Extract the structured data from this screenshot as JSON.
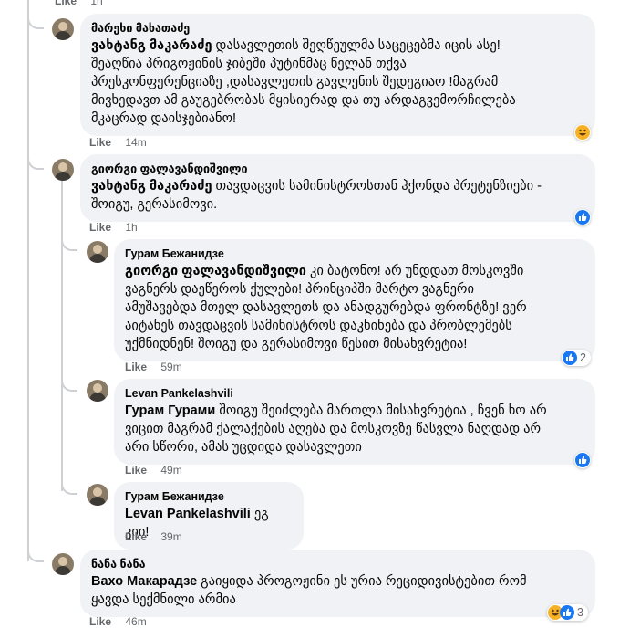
{
  "top_meta": {
    "like": "Like",
    "time": "1h"
  },
  "comments": [
    {
      "author": "მარეხი მახათაძე",
      "mention": "ვახტანგ მაკარაძე",
      "lines": [
        " დასავლეთის შეღწეულმა საცეცებმა იცის ასე!",
        "შეაღწია პრიგოჟინის ჯიბეში პუტინმაც წელან თქვა",
        "პრესკონფერენციაზე ,დასავლეთის გავლენის შედეგიაო !მაგრამ",
        "მივხედავთ ამ გაუგებრობას მყისიერად და თუ არდაგვემორჩილება",
        "მკაცრად დაისჯებიანო!"
      ],
      "like": "Like",
      "time": "14m",
      "reaction_count": ""
    },
    {
      "author": "გიორგი ფალავანდიშვილი",
      "mention": "ვახტანგ მაკარაძე",
      "lines": [
        " თავდაცვის სამინისტროსთან ჰქონდა პრეტენზიები -",
        "შოიგუ, გერასიმოვი."
      ],
      "like": "Like",
      "time": "1h",
      "reaction_count": ""
    },
    {
      "author": "Гурам Бежанидзе",
      "mention": "გიორგი ფალავანდიშვილი",
      "lines": [
        " კი ბატონო! არ უნდდათ მოსკოვში",
        "ვაგნერს დაეწეროს ქულები! პრინციპში მარტო ვაგნერი",
        "ამუშავებდა მთელ დასავლეთს და ანადგურებდა ფრონტზე! ვერ",
        "აიტანეს თავდაცვის სამინისტროს დაკნინება და პრობლემებს",
        "უქმნიდნენ! შოიგუ და გერასიმოვი წესით მისახვრეტია!"
      ],
      "like": "Like",
      "time": "59m",
      "reaction_count": "2"
    },
    {
      "author": "Levan Pankelashvili",
      "mention": "Гурам Гурами",
      "lines": [
        " შოიგუ შეიძლება მართლა მისახვრეტია , ჩვენ ხო არ",
        "ვიცით მაგრამ ქალაქების აღება და მოსკოვზე წასვლა ნაღდად არ",
        "არი სწორი, ამას უცდიდა დასავლეთი"
      ],
      "like": "Like",
      "time": "49m",
      "reaction_count": ""
    },
    {
      "author": "Гурам Бежанидзе",
      "mention": "Levan Pankelashvili",
      "lines": [
        " ეგ კიი!"
      ],
      "like": "Like",
      "time": "39m",
      "reaction_count": ""
    },
    {
      "author": "ნანა ნანა",
      "mention": "Вахо Макарадзе",
      "lines": [
        " გაიყიდა პროგოჟინი ეს ურია რეციდივისტებით რომ",
        "ყავდა სექმნილი არმია"
      ],
      "like": "Like",
      "time": "46m",
      "reaction_count": "3"
    }
  ],
  "colors": {
    "bubble": "#f0f2f5",
    "meta": "#65676b",
    "like_blue": "#1877f2",
    "haha_yellow": "#f7b125",
    "thread": "#ced0d4"
  },
  "icons": {
    "like": "like-reaction-icon",
    "haha": "haha-reaction-icon"
  }
}
